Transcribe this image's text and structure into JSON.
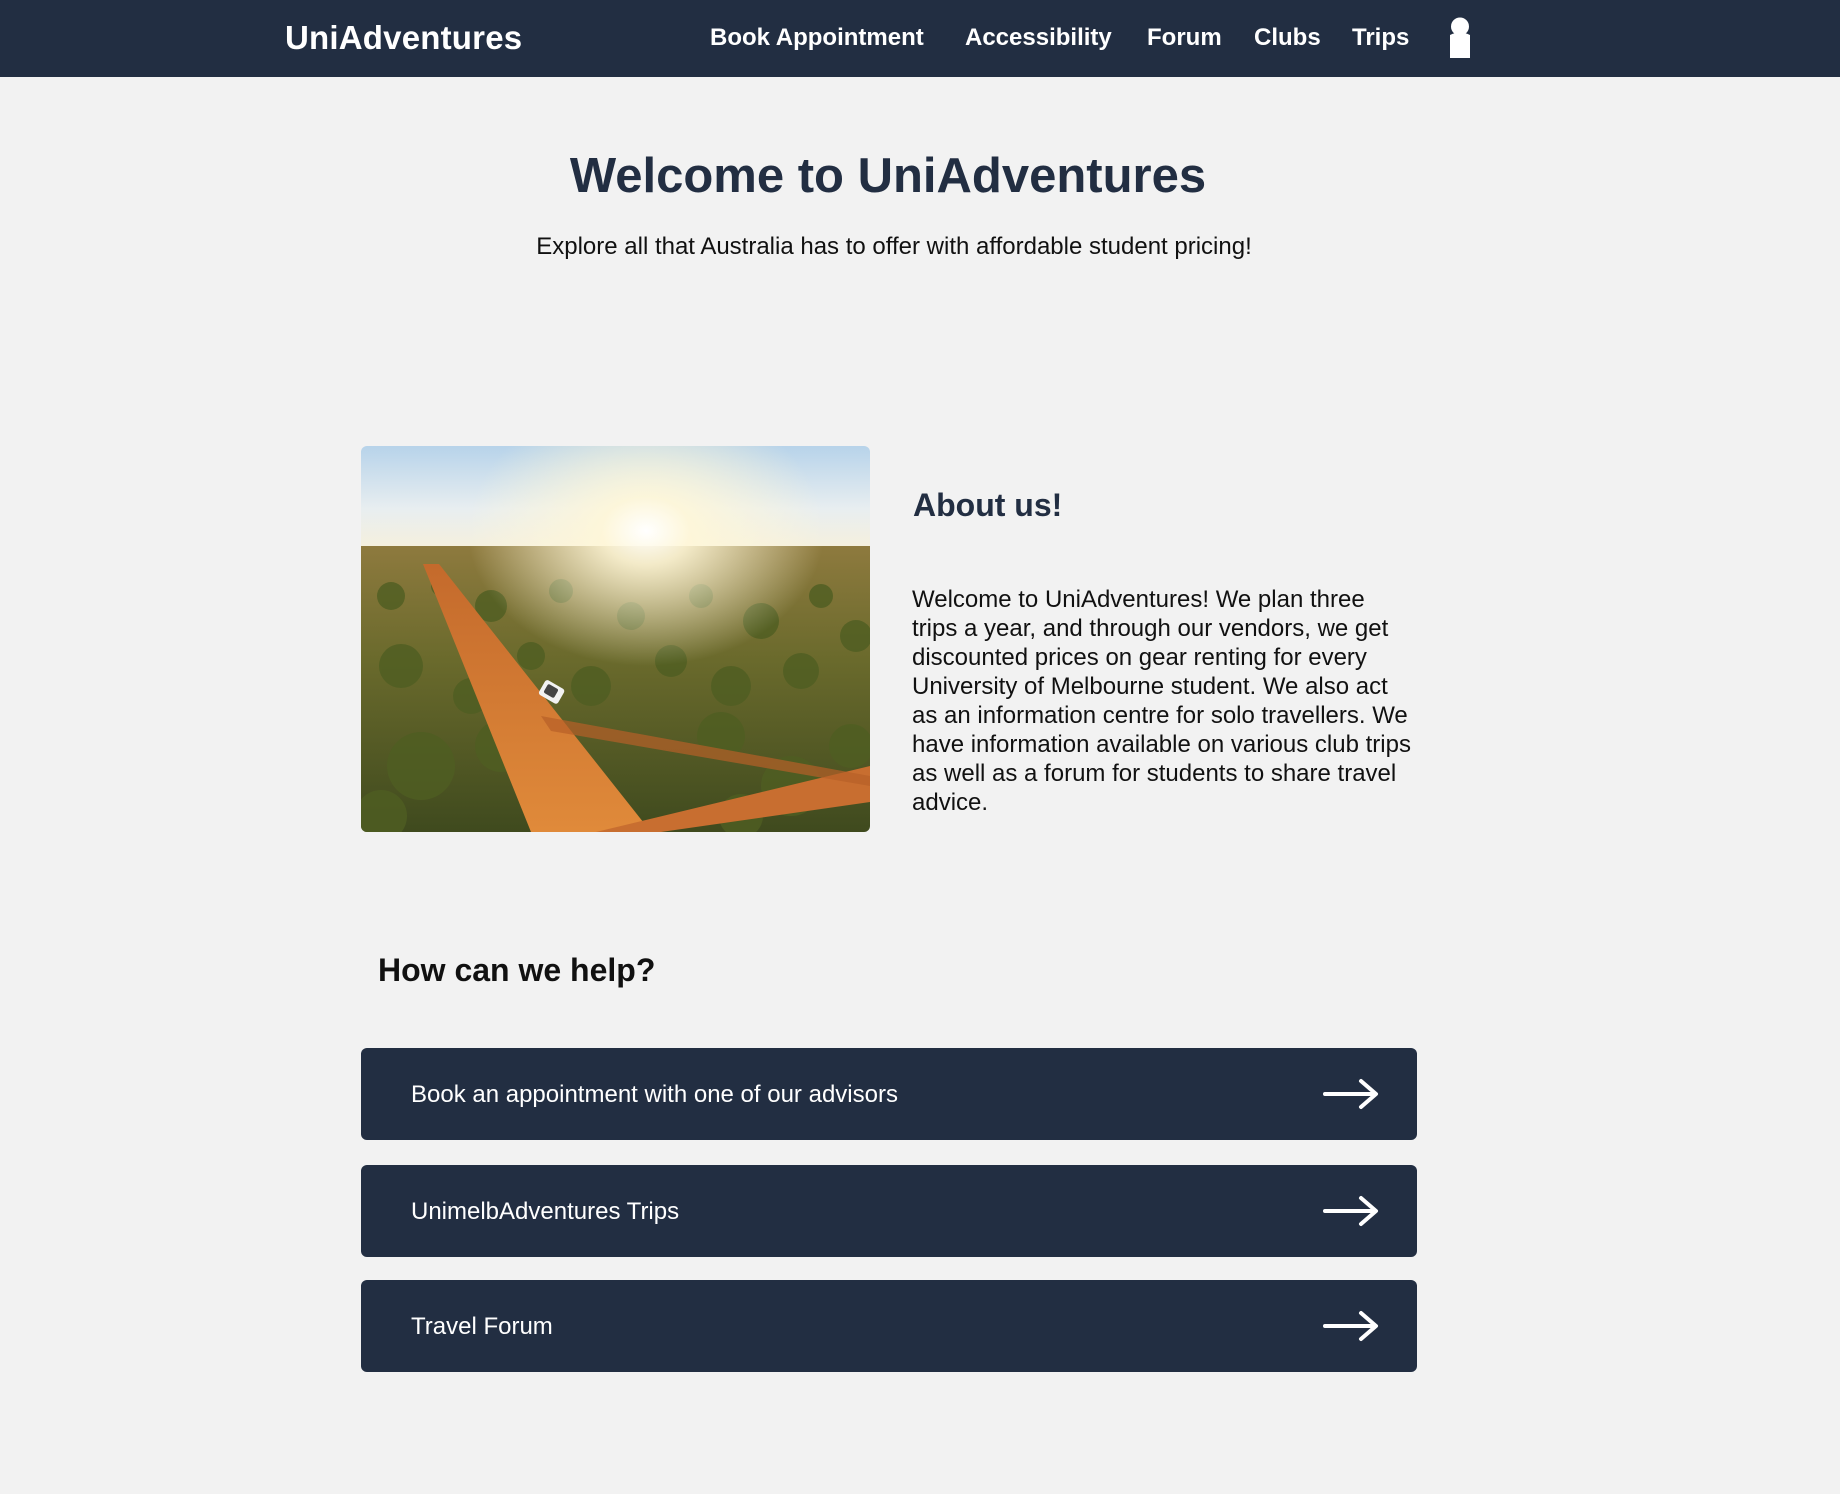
{
  "nav": {
    "brand": "UniAdventures",
    "links": [
      "Book Appointment",
      "Accessibility",
      "Forum",
      "Clubs",
      "Trips"
    ],
    "user_icon": "user-icon"
  },
  "hero": {
    "title": "Welcome to UniAdventures",
    "subtitle": "Explore all that Australia has to offer with affordable student pricing!"
  },
  "about": {
    "image_description_icon": "outback-photo",
    "title": "About us!",
    "body": "Welcome to UniAdventures! We plan three trips a year, and through our vendors, we get discounted prices on gear renting for every University of Melbourne student. We also act as an information centre for solo travellers. We have information available on various club trips as well as a forum for students to share travel advice."
  },
  "help": {
    "title": "How can we help?",
    "buttons": [
      {
        "label": "Book an appointment with one of our advisors",
        "icon": "arrow-right-icon"
      },
      {
        "label": "UnimelbAdventures Trips",
        "icon": "arrow-right-icon"
      },
      {
        "label": "Travel Forum",
        "icon": "arrow-right-icon"
      }
    ]
  },
  "colors": {
    "navbar": "#222e42",
    "page_background": "#f2f2f2",
    "accent_dark": "#222e42",
    "text": "#111111",
    "on_dark": "#ffffff"
  }
}
